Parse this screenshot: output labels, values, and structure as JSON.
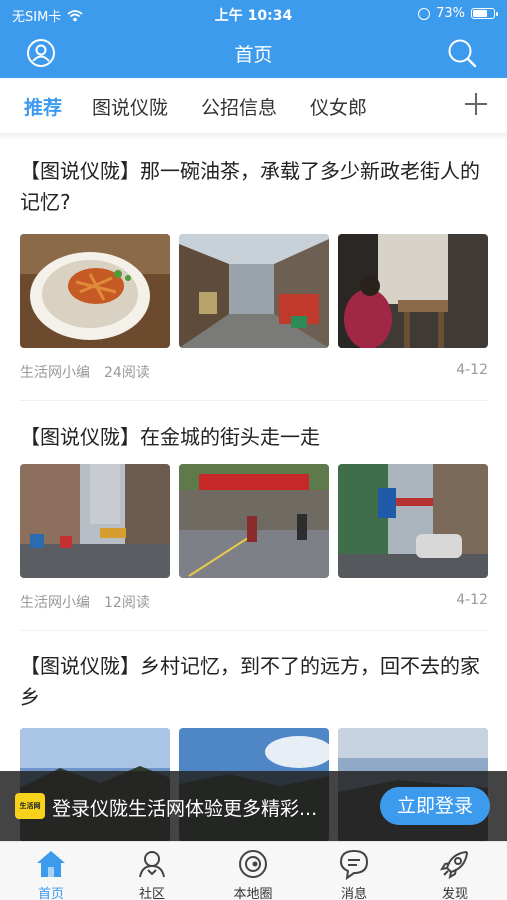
{
  "status_bar": {
    "carrier": "无SIM卡",
    "time": "上午 10:34",
    "battery_text": "73%",
    "battery_level": 0.73
  },
  "nav": {
    "title": "首页",
    "left_icon": "user-icon",
    "right_icon": "search-icon"
  },
  "tabs": [
    {
      "label": "推荐",
      "active": true
    },
    {
      "label": "图说仪陇",
      "active": false
    },
    {
      "label": "公招信息",
      "active": false
    },
    {
      "label": "仪女郎",
      "active": false
    }
  ],
  "articles": [
    {
      "title": "【图说仪陇】那一碗油茶，承载了多少新政老街人的记忆?",
      "author": "生活网小编",
      "reads": "24阅读",
      "date": "4-12"
    },
    {
      "title": "【图说仪陇】在金城的街头走一走",
      "author": "生活网小编",
      "reads": "12阅读",
      "date": "4-12"
    },
    {
      "title": "【图说仪陇】乡村记忆，到不了的远方，回不去的家乡",
      "author": "",
      "reads": "",
      "date": ""
    }
  ],
  "login_banner": {
    "logo_text": "生活网",
    "message": "登录仪陇生活网体验更多精彩...",
    "button": "立即登录"
  },
  "tabbar": [
    {
      "label": "首页",
      "icon": "home-icon",
      "active": true
    },
    {
      "label": "社区",
      "icon": "community-icon",
      "active": false
    },
    {
      "label": "本地圈",
      "icon": "local-circle-icon",
      "active": false
    },
    {
      "label": "消息",
      "icon": "message-icon",
      "active": false
    },
    {
      "label": "发现",
      "icon": "rocket-icon",
      "active": false
    }
  ],
  "colors": {
    "accent": "#3d9bee",
    "text": "#222222",
    "meta": "#999999"
  }
}
